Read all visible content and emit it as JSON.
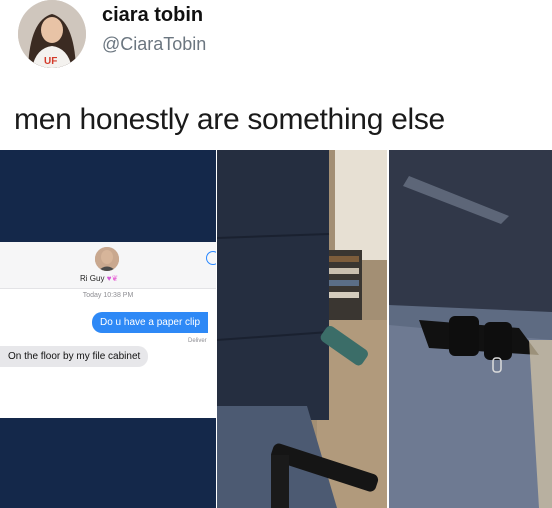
{
  "tweet": {
    "name": "ciara tobin",
    "handle": "@CiaraTobin",
    "text": "men honestly are something else",
    "avatar_shirt_text": "UF"
  },
  "screenshot": {
    "contact_name": "Ri Guy",
    "timestamp": "Today 10:38 PM",
    "outgoing_message": "Do u have a paper clip",
    "delivered_label": "Deliver",
    "incoming_message": "On the floor by my file cabinet"
  },
  "colors": {
    "imessage_blue": "#2e89f6",
    "incoming_gray": "#e7e7ea",
    "background_navy": "#14284a"
  }
}
